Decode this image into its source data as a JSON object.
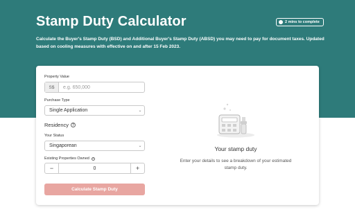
{
  "header": {
    "title": "Stamp Duty Calculator",
    "time_badge": "2 mins to complete",
    "description": "Calculate the Buyer's Stamp Duty (BSD) and Additional Buyer's Stamp Duty (ABSD) you may need to pay for document taxes. Updated based on cooling measures with effective on and after 15 Feb 2023."
  },
  "form": {
    "property_value": {
      "label": "Property Value",
      "prefix": "S$",
      "placeholder": "e.g. 650,000",
      "value": ""
    },
    "purchase_type": {
      "label": "Purchase Type",
      "value": "Single Application"
    },
    "residency": {
      "title": "Residency"
    },
    "your_status": {
      "label": "Your Status",
      "value": "Singaporean"
    },
    "existing_properties": {
      "label": "Existing Properties Owned",
      "value": "0",
      "minus": "−",
      "plus": "+"
    },
    "submit_label": "Calculate Stamp Duty"
  },
  "result": {
    "title": "Your stamp duty",
    "description": "Enter your details to see a breakdown of your estimated stamp duty."
  },
  "colors": {
    "brand": "#2e7b7a",
    "button_disabled": "#e8a6a1"
  }
}
